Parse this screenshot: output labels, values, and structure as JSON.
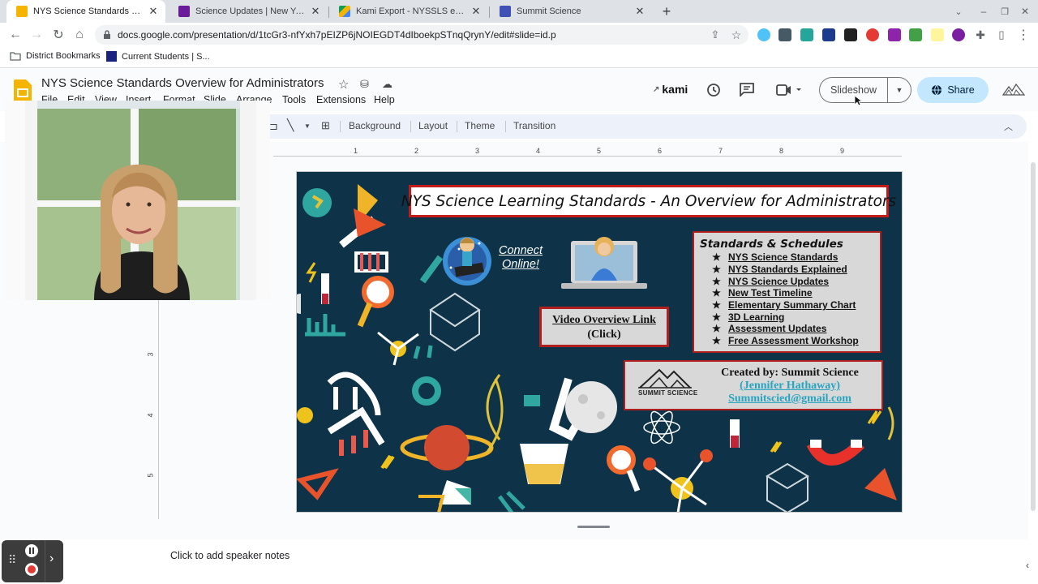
{
  "browser": {
    "tabs": [
      {
        "title": "NYS Science Standards Overview",
        "active": true,
        "favicon": "slides-icon"
      },
      {
        "title": "Science Updates | New York State",
        "active": false,
        "favicon": "nysed-icon"
      },
      {
        "title": "Kami Export - NYSSLS explained",
        "active": false,
        "favicon": "drive-icon"
      },
      {
        "title": "Summit Science",
        "active": false,
        "favicon": "doc-icon"
      }
    ],
    "close_glyph": "✕",
    "new_tab_glyph": "+",
    "url": "docs.google.com/presentation/d/1tcGr3-nfYxh7pEIZP6jNOIEGDT4dIboekpSTnqQrynY/edit#slide=id.p",
    "bookmarks": [
      {
        "label": "District Bookmarks",
        "icon": "folder-icon"
      },
      {
        "label": "Current Students | S...",
        "icon": "school-icon"
      }
    ]
  },
  "docs": {
    "title": "NYS Science Standards Overview for Administrators",
    "menus": [
      "File",
      "Edit",
      "View",
      "Insert",
      "Format",
      "Slide",
      "Arrange",
      "Tools",
      "Extensions",
      "Help"
    ],
    "kami_label": "kami",
    "slideshow_label": "Slideshow",
    "share_label": "Share",
    "toolbar": {
      "background_label": "Background",
      "layout_label": "Layout",
      "theme_label": "Theme",
      "transition_label": "Transition"
    },
    "ruler_numbers": [
      "1",
      "2",
      "3",
      "4",
      "5",
      "6",
      "7",
      "8",
      "9"
    ],
    "vruler_numbers": [
      "3",
      "4",
      "5"
    ],
    "speaker_notes_placeholder": "Click to add speaker notes"
  },
  "slide": {
    "title": "NYS Science Learning Standards - An Overview for Administrators",
    "connect_line1": "Connect",
    "connect_line2": "Online!",
    "video_link": "Video Overview  Link",
    "video_click": "(Click)",
    "standards_heading": "Standards & Schedules",
    "star_glyph": "★",
    "standards_links": [
      "NYS Science Standards",
      "NYS Standards Explained",
      "NYS Science Updates",
      "New Test Timeline",
      "Elementary Summary Chart",
      "3D Learning",
      "Assessment Updates",
      "Free Assessment Workshop"
    ],
    "credit_logo_text": "SUMMIT SCIENCE",
    "created_by": "Created by:  Summit Science",
    "author": "(Jennifer Hathaway)",
    "email": "Summitscied@gmail.com"
  },
  "colors": {
    "slide_bg": "#0e3349",
    "title_border": "#c41a1a",
    "link_cyan": "#27a4c0",
    "share_bg": "#c2e7ff"
  }
}
